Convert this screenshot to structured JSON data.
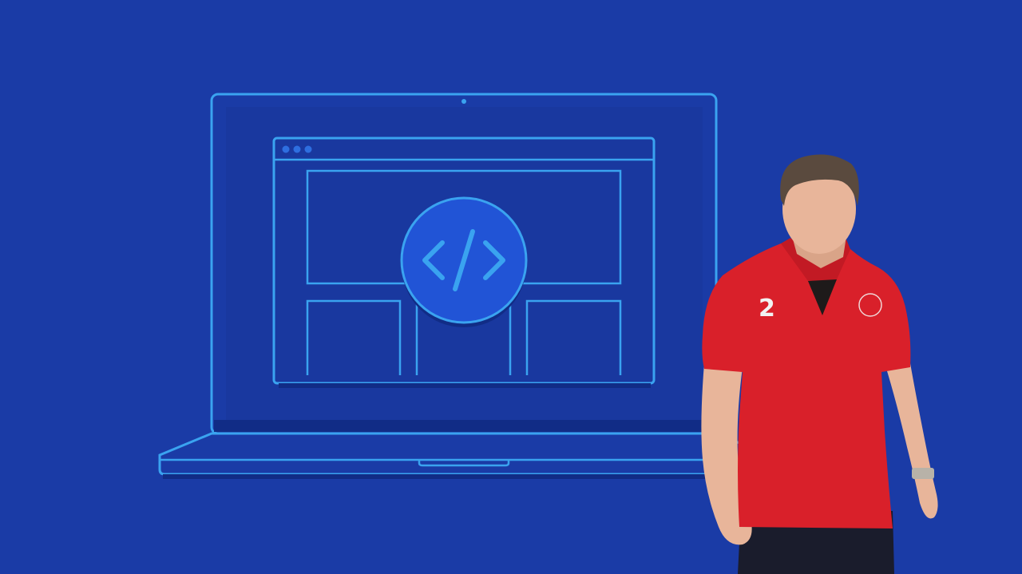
{
  "illustration": {
    "subject": "laptop",
    "icon": "code-brackets-icon"
  },
  "photo": {
    "subject": "person"
  },
  "colors": {
    "background": "#1a3ba6",
    "line": "#3aa3f0",
    "screen_fill": "#19389f",
    "bezel_dark": "#112c86",
    "badge": "#2154d6",
    "shirt": "#d9202a",
    "skin": "#e8b59a",
    "hair": "#5a4a3e",
    "pants": "#1a1c2c"
  }
}
